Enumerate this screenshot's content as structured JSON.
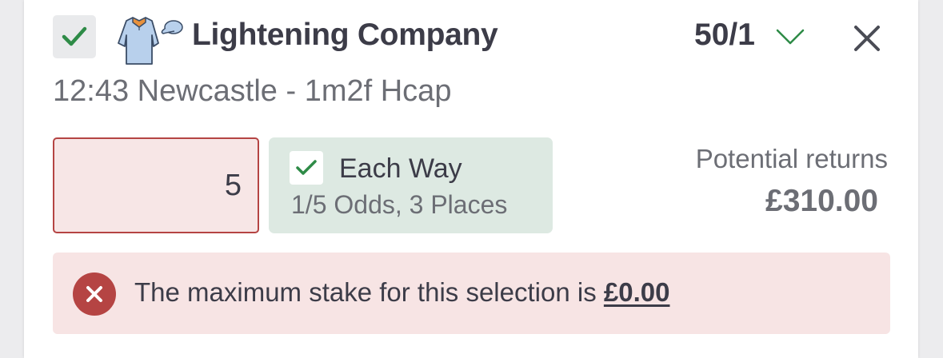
{
  "selection": {
    "name": "Lightening Company",
    "odds": "50/1",
    "race": "12:43 Newcastle - 1m2f Hcap",
    "selected": true
  },
  "stake": {
    "value": "5"
  },
  "each_way": {
    "label": "Each Way",
    "terms": "1/5 Odds, 3 Places",
    "checked": true
  },
  "returns": {
    "label": "Potential returns",
    "value": "£310.00"
  },
  "error": {
    "message": "The maximum stake for this selection is ",
    "amount": "£0.00"
  },
  "colors": {
    "check_green": "#2e8b47",
    "error_red": "#b54443",
    "error_bg": "#f7e4e4",
    "each_way_bg": "#dde9e2",
    "text_dark": "#3c3c48",
    "text_muted": "#6c6e75"
  },
  "icons": {
    "select": "checkmark-icon",
    "silks": "jockey-silks-icon",
    "odds_toggle": "chevron-down-icon",
    "remove": "close-icon",
    "error": "error-circle-x-icon"
  }
}
